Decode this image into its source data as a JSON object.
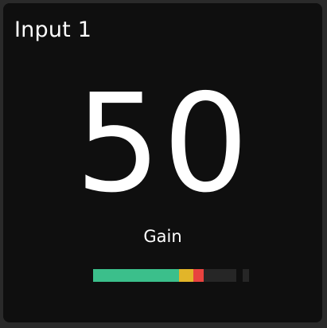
{
  "tile": {
    "title": "Input 1",
    "value": "50",
    "label": "Gain"
  },
  "meter": {
    "level": 0.77,
    "green_end": 0.6,
    "yellow_end": 0.7,
    "colors": {
      "green": "#3bbf8b",
      "yellow": "#e2b529",
      "red": "#e8433f",
      "track": "#262626",
      "background": "#0f0f0f"
    }
  }
}
